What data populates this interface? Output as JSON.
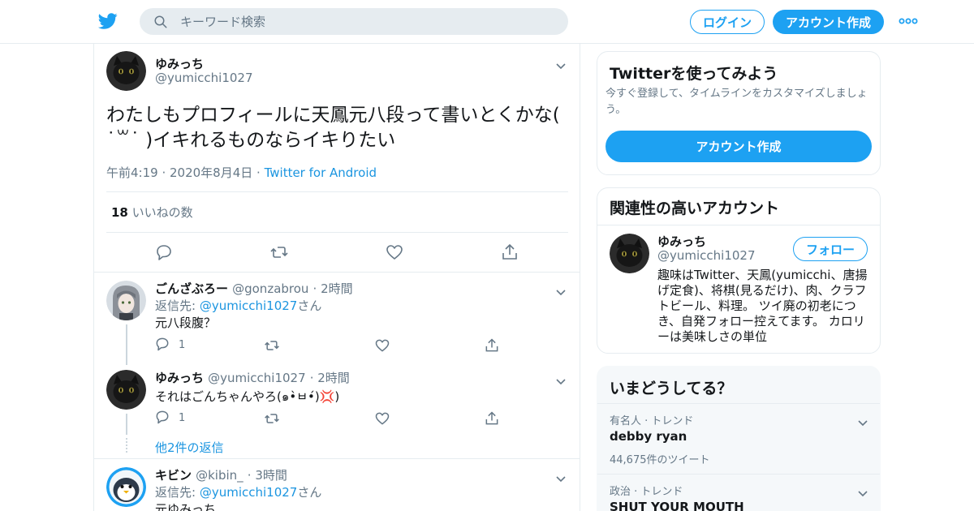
{
  "header": {
    "search_placeholder": "キーワード検索",
    "login_label": "ログイン",
    "signup_label": "アカウント作成"
  },
  "main_tweet": {
    "name": "ゆみっち",
    "handle": "@yumicchi1027",
    "text": "わたしもプロフィールに天鳳元八段って書いとくかな( ˙꒳˙ )イキれるものならイキりたい",
    "time": "午前4:19",
    "date": "2020年8月4日",
    "source": "Twitter for Android",
    "likes_count": "18",
    "likes_label": "いいねの数"
  },
  "replies": [
    {
      "name": "ごんざぶろー",
      "handle": "@gonzabrou",
      "time": "2時間",
      "reply_prefix": "返信先: ",
      "reply_to": "@yumicchi1027",
      "reply_suffix": "さん",
      "text": "元八段腹？",
      "reply_count": "1"
    },
    {
      "name": "ゆみっち",
      "handle": "@yumicchi1027",
      "time": "2時間",
      "text": "それはごんちゃんやろ(๑•̀ㅂ•́)💢)",
      "reply_count": "1"
    },
    {
      "name": "キビン",
      "handle": "@kibin_",
      "time": "3時間",
      "reply_prefix": "返信先: ",
      "reply_to": "@yumicchi1027",
      "reply_suffix": "さん",
      "text": "元ゆみっち"
    }
  ],
  "more_replies": "他2件の返信",
  "sidebar": {
    "try_card": {
      "title": "Twitterを使ってみよう",
      "subtitle": "今すぐ登録して、タイムラインをカスタマイズしましょう。",
      "button": "アカウント作成"
    },
    "related_card": {
      "title": "関連性の高いアカウント",
      "name": "ゆみっち",
      "handle": "@yumicchi1027",
      "follow_label": "フォロー",
      "bio": "趣味はTwitter、天鳳(yumicchi、唐揚げ定食)、将棋(見るだけ)、肉、クラフトビール、料理。 ツイ廃の初老につき、自発フォロー控えてます。 カロリーは美味しさの単位"
    },
    "trends_card": {
      "title": "いまどうしてる？",
      "trends": [
        {
          "context": "有名人 · トレンド",
          "name": "debby ryan",
          "count": "44,675件のツイート"
        },
        {
          "context": "政治 · トレンド",
          "name": "SHUT YOUR MOUTH",
          "count": ""
        }
      ]
    }
  },
  "colors": {
    "accent": "#1da1f2",
    "link": "#1b95e0",
    "secondary_text": "#657786",
    "border": "#e6ecf0"
  }
}
